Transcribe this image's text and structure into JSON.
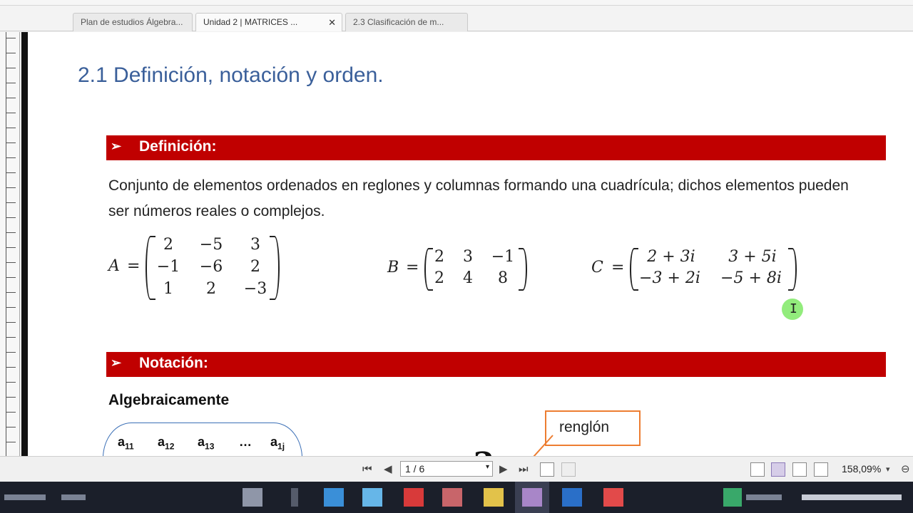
{
  "tabs": [
    {
      "label": "Plan de estudios Álgebra...",
      "active": false
    },
    {
      "label": "Unidad 2 | MATRICES ...",
      "active": true
    },
    {
      "label": "2.3 Clasificación de m...",
      "active": false
    }
  ],
  "tab_close": "✕",
  "document": {
    "heading": "2.1 Definición, notación y orden.",
    "definicion_label": "Definición:",
    "definicion_text": "Conjunto de elementos ordenados en reglones y columnas formando una cuadrícula; dichos elementos pueden ser números reales o complejos.",
    "notacion_label": "Notación:",
    "algebraicamente": "Algebraicamente",
    "renglon": "renglón",
    "bullet": "➢",
    "eq": "=",
    "matrices": [
      {
        "name": "A",
        "rows": [
          [
            "2",
            "−5",
            "3"
          ],
          [
            "−1",
            "−6",
            "2"
          ],
          [
            "1",
            "2",
            "−3"
          ]
        ]
      },
      {
        "name": "B",
        "rows": [
          [
            "2",
            "3",
            "−1"
          ],
          [
            "2",
            "4",
            "8"
          ]
        ]
      },
      {
        "name": "C",
        "rows": [
          [
            "2 + 3i",
            "3 + 5i"
          ],
          [
            "−3 + 2i",
            "−5 + 8i"
          ]
        ]
      }
    ],
    "general_row": [
      {
        "base": "a",
        "sub": "11"
      },
      {
        "base": "a",
        "sub": "12"
      },
      {
        "base": "a",
        "sub": "13"
      },
      {
        "base": "…",
        "sub": ""
      },
      {
        "base": "a",
        "sub": "1j"
      }
    ],
    "big_a": "a"
  },
  "toolbar": {
    "page_indicator": "1 / 6",
    "zoom": "158,09%",
    "first": "⏮",
    "prev": "◀",
    "next": "▶",
    "last": "⏭",
    "dropdown": "▾",
    "zoom_dropdown": "▾",
    "zoom_out": "⊖"
  },
  "cursor_glyph": "I"
}
